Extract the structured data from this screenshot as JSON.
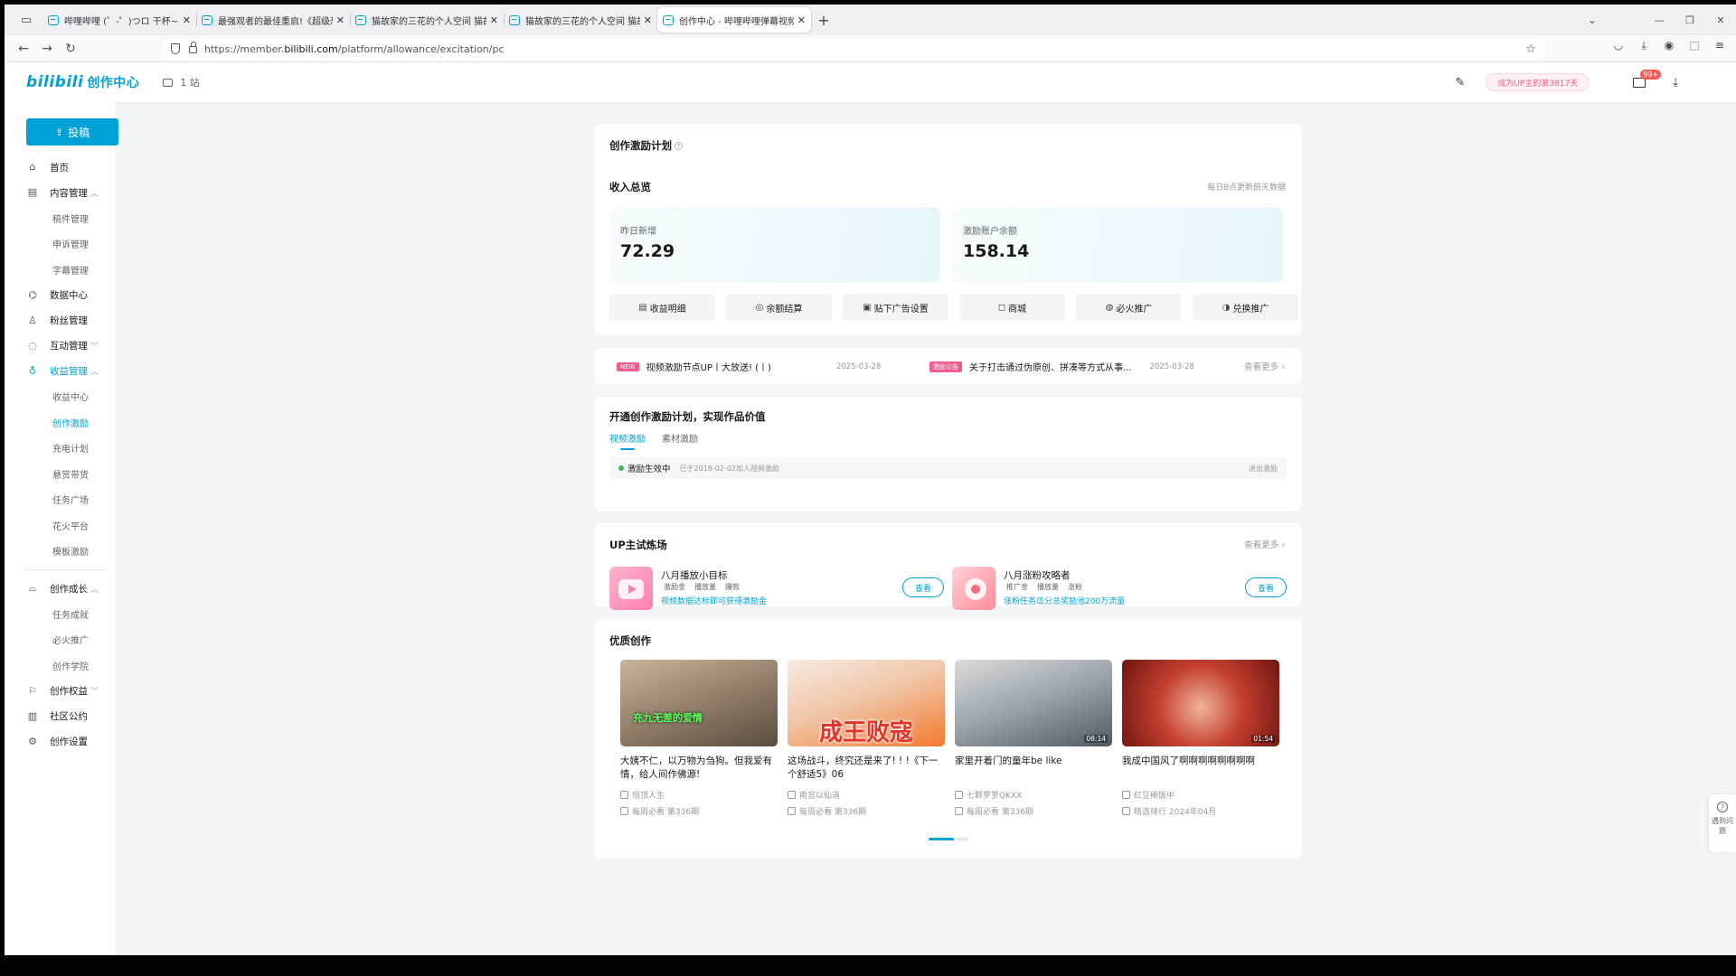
{
  "browser": {
    "tabs": [
      {
        "title": "哔哩哔哩 (゜-゜)つロ 干杯~-bil",
        "active": false
      },
      {
        "title": "最强观者的最佳重启!《超级恐",
        "active": false
      },
      {
        "title": "猫故家的三花的个人空间 猫故",
        "active": false
      },
      {
        "title": "猫故家的三花的个人空间 猫故",
        "active": false
      },
      {
        "title": "创作中心 - 哔哩哔哩弹幕视频网",
        "active": true
      }
    ],
    "url_prefix": "https://member.",
    "url_domain": "bilibili.com",
    "url_path": "/platform/allowance/excitation/pc"
  },
  "header": {
    "logo": "bilibili",
    "logo_sub": "创作中心",
    "station": "1 站",
    "up_pill": "成为UP主的第3817天",
    "mail_badge": "99+"
  },
  "sidebar": {
    "post_label": "投稿",
    "items": [
      {
        "label": "首页",
        "icon": "home-icon"
      },
      {
        "label": "内容管理",
        "icon": "document-icon",
        "expanded": true,
        "children": [
          "稿件管理",
          "申诉管理",
          "字幕管理"
        ]
      },
      {
        "label": "数据中心",
        "icon": "chart-icon"
      },
      {
        "label": "粉丝管理",
        "icon": "user-icon"
      },
      {
        "label": "互动管理",
        "icon": "chat-icon",
        "expanded": false
      },
      {
        "label": "收益管理",
        "icon": "money-bag-icon",
        "expanded": true,
        "active": true,
        "children": [
          "收益中心",
          "创作激励",
          "充电计划",
          "悬赏带货",
          "任务广场",
          "花火平台",
          "模板激励"
        ]
      },
      {
        "label": "创作成长",
        "icon": "graduation-cap-icon",
        "expanded": true,
        "children": [
          "任务成就",
          "必火推广",
          "创作学院"
        ]
      },
      {
        "label": "创作权益",
        "icon": "flag-icon",
        "expanded": false
      },
      {
        "label": "社区公约",
        "icon": "book-icon"
      },
      {
        "label": "创作设置",
        "icon": "gear-icon"
      }
    ],
    "active_child": "创作激励"
  },
  "plan": {
    "title": "创作激励计划",
    "overview_title": "收入总览",
    "update_note": "每日8点更新前天数据",
    "yesterday_label": "昨日新增",
    "yesterday_value": "72.29",
    "balance_label": "激励账户余额",
    "balance_value": "158.14",
    "quick_buttons": [
      {
        "label": "收益明细",
        "icon": "list-icon"
      },
      {
        "label": "余额结算",
        "icon": "coin-icon"
      },
      {
        "label": "贴下广告设置",
        "icon": "ad-icon"
      },
      {
        "label": "商城",
        "icon": "bag-icon"
      },
      {
        "label": "必火推广",
        "icon": "fire-icon"
      },
      {
        "label": "兑换推广",
        "icon": "exchange-icon"
      }
    ]
  },
  "news": {
    "items": [
      {
        "tag": "NEW",
        "text": "视频激励节点UP丨大放送! (丨)",
        "date": "2025-03-28"
      },
      {
        "tag": "激励公告",
        "text": "关于打击通过伪原创、拼凑等方式从事...",
        "date": "2025-03-28"
      }
    ],
    "more": "查看更多"
  },
  "join": {
    "title": "开通创作激励计划，实现作品价值",
    "tabs": [
      "视频激励",
      "素材激励"
    ],
    "status": "激励生效中",
    "since": "已于2018-02-02加入视频激励",
    "quit": "退出激励"
  },
  "trial": {
    "title": "UP主试炼场",
    "more": "查看更多",
    "tasks": [
      {
        "name": "八月播放小目标",
        "tags": [
          "激励金",
          "播放量",
          "爆款"
        ],
        "desc": "视频数据达标即可获得激励金",
        "button": "查看"
      },
      {
        "name": "八月涨粉攻略者",
        "tags": [
          "推广金",
          "播放量",
          "涨粉"
        ],
        "desc": "涨粉任务瓜分总奖励池200万流量",
        "button": "查看"
      }
    ]
  },
  "quality": {
    "title": "优质创作",
    "videos": [
      {
        "title": "大姨不仁，以万物为刍狗。但我爱有情，给人间作佛源!",
        "caption": "充九无差的爱情",
        "author": "恒顶人生",
        "rank": "每周必看 第336期",
        "duration": ""
      },
      {
        "title": "这场战斗，终究还是来了! ! !《下一个舒适5》06",
        "caption": "成王败寇",
        "author": "南宫以仙道",
        "rank": "每周必看 第336期",
        "duration": ""
      },
      {
        "title": "家里开着门的童年be like",
        "caption": "",
        "author": "七颗罗罗QKXX",
        "rank": "每周必看 第336期",
        "duration": "08:14"
      },
      {
        "title": "我成中国风了啊啊啊啊啊啊啊啊",
        "caption": "",
        "author": "红豆稀饭中",
        "rank": "精选排行 2024年04月",
        "duration": "01:54"
      }
    ]
  },
  "float_help": "遇到问题"
}
